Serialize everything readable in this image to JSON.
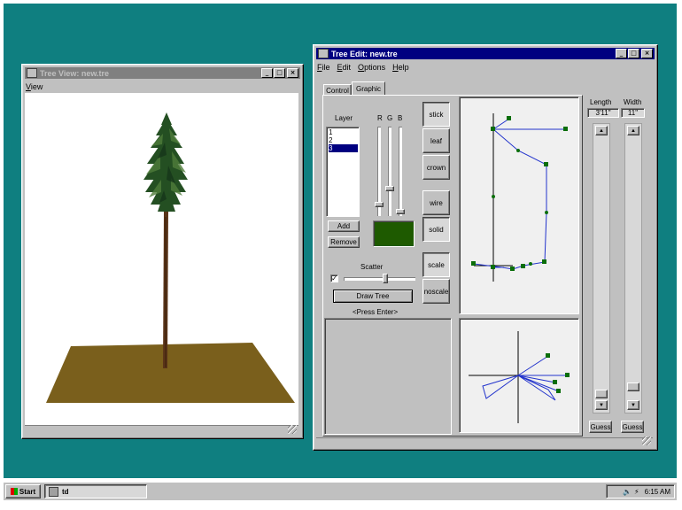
{
  "tree_view": {
    "title": "Tree View: new.tre",
    "menu": [
      "View"
    ]
  },
  "tree_edit": {
    "title": "Tree Edit: new.tre",
    "menu": [
      "File",
      "Edit",
      "Options",
      "Help"
    ],
    "tabs": [
      "Control",
      "Graphic"
    ],
    "layer_label": "Layer",
    "layers": [
      "1",
      "2",
      "3"
    ],
    "selected_layer": "3",
    "rgb_labels": [
      "R",
      "G",
      "B"
    ],
    "add_label": "Add",
    "remove_label": "Remove",
    "swatch_color": "#1e5a00",
    "scatter_label": "Scatter",
    "scatter_checked": true,
    "draw_tree_label": "Draw Tree",
    "press_enter_label": "<Press Enter>",
    "mode_buttons": [
      "stick",
      "leaf",
      "crown",
      "wire",
      "solid",
      "scale",
      "noscale"
    ],
    "length_label": "Length",
    "length_value": "3'11\"",
    "width_label": "Width",
    "width_value": "11\"",
    "guess_label": "Guess"
  },
  "taskbar": {
    "start_label": "Start",
    "task_label": "td",
    "clock": "6:15 AM"
  },
  "colors": {
    "desktop": "#0f7f80",
    "ground": "#7a5f1c",
    "curve": "#2233cc",
    "point": "#0a6e0a"
  }
}
